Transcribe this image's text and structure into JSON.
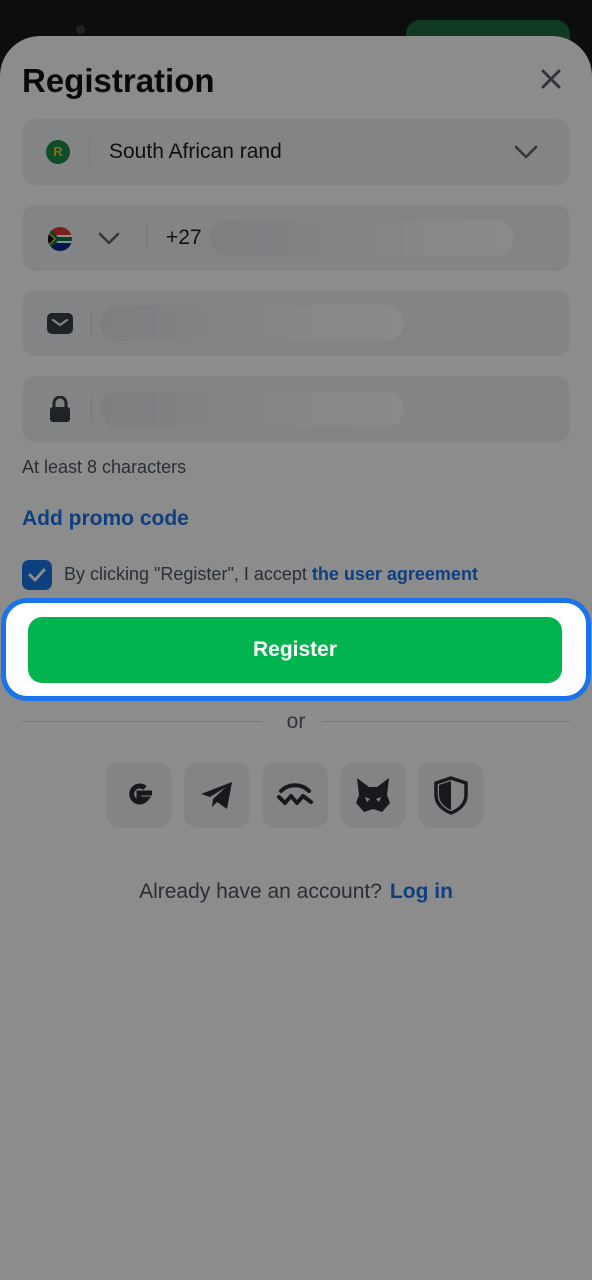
{
  "header": {
    "title": "Registration"
  },
  "currency": {
    "value": "South African rand",
    "symbol": "R"
  },
  "phone": {
    "country_code": "+27"
  },
  "password": {
    "hint": "At least 8 characters"
  },
  "promo": {
    "label": "Add promo code"
  },
  "agreement": {
    "checked": true,
    "text": "By clicking \"Register\", I accept ",
    "link": "the user agreement"
  },
  "register": {
    "label": "Register"
  },
  "divider": {
    "label": "or"
  },
  "social": [
    "google-icon",
    "telegram-icon",
    "walletconnect-icon",
    "metamask-icon",
    "shield-icon"
  ],
  "login": {
    "prompt": "Already have an account?",
    "link": "Log in"
  },
  "colors": {
    "accent": "#1a73e8",
    "primary_button": "#02b44d",
    "field_bg": "#eef0f3"
  }
}
